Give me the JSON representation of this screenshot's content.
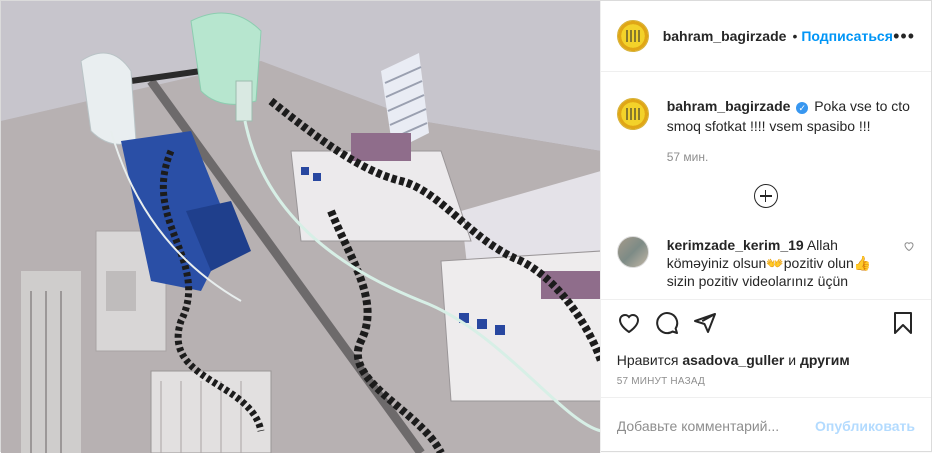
{
  "post": {
    "author": "bahram_bagirzade",
    "follow_separator": "•",
    "follow_label": "Подписаться",
    "more_label": "•••",
    "caption_user": "bahram_bagirzade",
    "caption_text": " Poka vse to cto smoq sfotkat !!!! vsem spasibo !!!",
    "caption_time": "57 мин.",
    "comments": [
      {
        "user": "kerimzade_kerim_19",
        "text": " Allah köməyiniz olsun👐pozitiv olun👍 sizin pozitiv videolarınız üçün"
      }
    ],
    "likes_prefix": "Нравится ",
    "likes_user": "asadova_guller",
    "likes_mid": " и ",
    "likes_suffix": "другим",
    "timestamp": "57 МИНУТ НАЗАД",
    "comment_placeholder": "Добавьте комментарий...",
    "publish_label": "Опубликовать"
  },
  "icons": {
    "heart": "heart-icon",
    "comment": "comment-icon",
    "share": "share-icon",
    "save": "bookmark-icon",
    "load_more": "plus-circle-icon",
    "verified": "verified-badge-icon"
  }
}
